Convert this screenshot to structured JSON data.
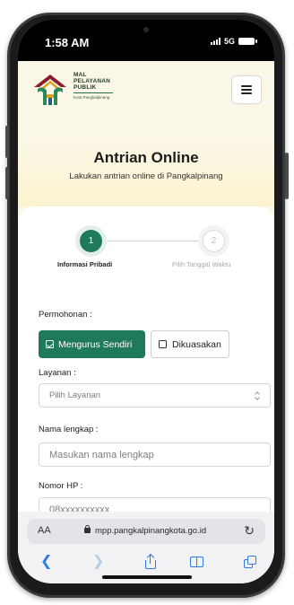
{
  "status_bar": {
    "time": "1:58 AM",
    "network": "5G"
  },
  "header": {
    "brand_lines": [
      "MAL",
      "PELAYANAN",
      "PUBLIK"
    ],
    "brand_sub": "Kota Pangkalpinang",
    "menu_icon": "hamburger-icon"
  },
  "hero": {
    "title": "Antrian Online",
    "subtitle": "Lakukan antrian online di Pangkalpinang"
  },
  "stepper": {
    "steps": [
      {
        "number": "1",
        "label": "Informasi Pribadi",
        "active": true
      },
      {
        "number": "2",
        "label": "Pilih Tanggal Waktu",
        "active": false
      }
    ]
  },
  "form": {
    "permohonan_label": "Permohonan :",
    "options": [
      {
        "label": "Mengurus Sendiri",
        "selected": true
      },
      {
        "label": "Dikuasakan",
        "selected": false
      }
    ],
    "layanan_label": "Layanan :",
    "layanan_value": "Pilih Layanan",
    "nama_label": "Nama lengkap :",
    "nama_placeholder": "Masukan nama lengkap",
    "hp_label": "Nomor HP :",
    "hp_placeholder": "08xxxxxxxxxx"
  },
  "browser": {
    "text_size_label": "AA",
    "url": "mpp.pangkalpinangkota.go.id",
    "toolbar_icons": [
      "back-icon",
      "forward-icon",
      "share-icon",
      "bookmarks-icon",
      "tabs-icon"
    ]
  },
  "colors": {
    "primary_green": "#1e7a5a",
    "header_bg": "#fbf7e7",
    "link_blue": "#2f7ce0"
  }
}
